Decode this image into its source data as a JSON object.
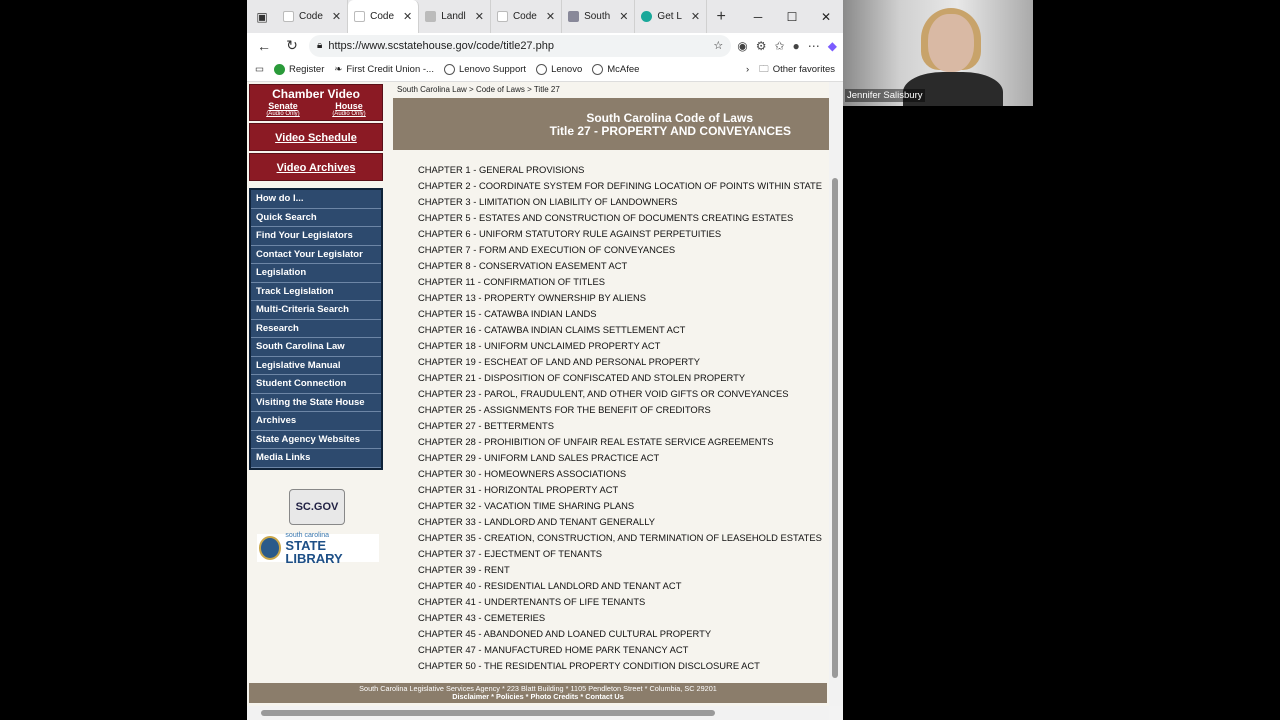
{
  "browser": {
    "tabs": [
      {
        "label": "Code",
        "active": false
      },
      {
        "label": "Code",
        "active": true
      },
      {
        "label": "Landl",
        "active": false
      },
      {
        "label": "Code",
        "active": false
      },
      {
        "label": "South",
        "active": false
      },
      {
        "label": "Get L",
        "active": false
      }
    ],
    "url": "https://www.scstatehouse.gov/code/title27.php",
    "favorites": [
      "Register",
      "First Credit Union -...",
      "Lenovo Support",
      "Lenovo",
      "McAfee"
    ],
    "other_favorites": "Other favorites"
  },
  "sidebar": {
    "chamber_video": "Chamber Video",
    "senate": "Senate",
    "house": "House",
    "audio_only": "(Audio Only)",
    "video_schedule": "Video Schedule",
    "video_archives": "Video Archives",
    "menu": [
      "How do I...",
      "Quick Search",
      "Find Your Legislators",
      "Contact Your Legislator",
      "Legislation",
      "Track Legislation",
      "Multi-Criteria Search",
      "Research",
      "South Carolina Law",
      "Legislative Manual",
      "Student Connection",
      "Visiting the State House",
      "Archives",
      "State Agency Websites",
      "Media Links"
    ],
    "logo_scgov": "SC.GOV",
    "logo_library_top": "south carolina",
    "logo_library_bottom": "STATE LIBRARY"
  },
  "main": {
    "breadcrumb": "South Carolina Law > Code of Laws > Title 27",
    "title_line1": "South Carolina Code of Laws",
    "title_line2": "Title 27 - PROPERTY AND CONVEYANCES",
    "chapters": [
      "CHAPTER 1 - GENERAL PROVISIONS",
      "CHAPTER 2 - COORDINATE SYSTEM FOR DEFINING LOCATION OF POINTS WITHIN STATE",
      "CHAPTER 3 - LIMITATION ON LIABILITY OF LANDOWNERS",
      "CHAPTER 5 - ESTATES AND CONSTRUCTION OF DOCUMENTS CREATING ESTATES",
      "CHAPTER 6 - UNIFORM STATUTORY RULE AGAINST PERPETUITIES",
      "CHAPTER 7 - FORM AND EXECUTION OF CONVEYANCES",
      "CHAPTER 8 - CONSERVATION EASEMENT ACT",
      "CHAPTER 11 - CONFIRMATION OF TITLES",
      "CHAPTER 13 - PROPERTY OWNERSHIP BY ALIENS",
      "CHAPTER 15 - CATAWBA INDIAN LANDS",
      "CHAPTER 16 - CATAWBA INDIAN CLAIMS SETTLEMENT ACT",
      "CHAPTER 18 - UNIFORM UNCLAIMED PROPERTY ACT",
      "CHAPTER 19 - ESCHEAT OF LAND AND PERSONAL PROPERTY",
      "CHAPTER 21 - DISPOSITION OF CONFISCATED AND STOLEN PROPERTY",
      "CHAPTER 23 - PAROL, FRAUDULENT, AND OTHER VOID GIFTS OR CONVEYANCES",
      "CHAPTER 25 - ASSIGNMENTS FOR THE BENEFIT OF CREDITORS",
      "CHAPTER 27 - BETTERMENTS",
      "CHAPTER 28 - PROHIBITION OF UNFAIR REAL ESTATE SERVICE AGREEMENTS",
      "CHAPTER 29 - UNIFORM LAND SALES PRACTICE ACT",
      "CHAPTER 30 - HOMEOWNERS ASSOCIATIONS",
      "CHAPTER 31 - HORIZONTAL PROPERTY ACT",
      "CHAPTER 32 - VACATION TIME SHARING PLANS",
      "CHAPTER 33 - LANDLORD AND TENANT GENERALLY",
      "CHAPTER 35 - CREATION, CONSTRUCTION, AND TERMINATION OF LEASEHOLD ESTATES",
      "CHAPTER 37 - EJECTMENT OF TENANTS",
      "CHAPTER 39 - RENT",
      "CHAPTER 40 - RESIDENTIAL LANDLORD AND TENANT ACT",
      "CHAPTER 41 - UNDERTENANTS OF LIFE TENANTS",
      "CHAPTER 43 - CEMETERIES",
      "CHAPTER 45 - ABANDONED AND LOANED CULTURAL PROPERTY",
      "CHAPTER 47 - MANUFACTURED HOME PARK TENANCY ACT",
      "CHAPTER 50 - THE RESIDENTIAL PROPERTY CONDITION DISCLOSURE ACT"
    ],
    "footer_line1": "South Carolina Legislative Services Agency * 223 Blatt Building * 1105 Pendleton Street * Columbia, SC 29201",
    "footer_line2": "Disclaimer * Policies * Photo Credits * Contact Us"
  },
  "video": {
    "participant_name": "Jennifer Salisbury"
  }
}
